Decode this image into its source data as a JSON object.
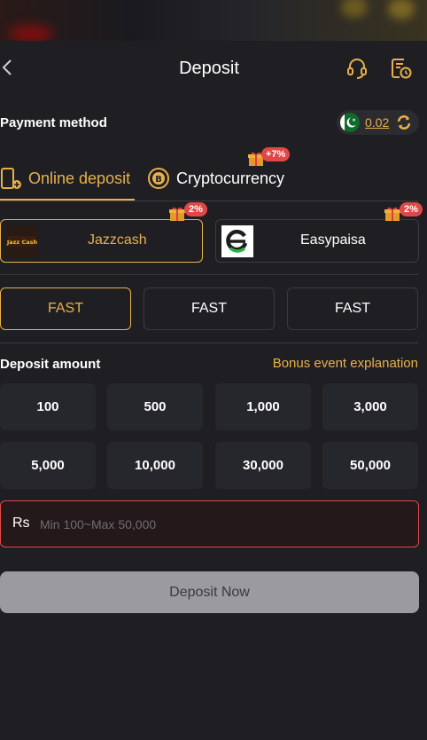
{
  "header": {
    "title": "Deposit",
    "back_icon": "chevron-left-icon",
    "support_icon": "headset-icon",
    "history_icon": "history-icon"
  },
  "payment_method": {
    "label": "Payment method",
    "balance": "0.02",
    "flag_icon": "pakistan-flag-icon",
    "refresh_icon": "refresh-icon"
  },
  "tabs": [
    {
      "label": "Online deposit",
      "active": true
    },
    {
      "label": "Cryptocurrency",
      "active": false,
      "badge": "+7%"
    }
  ],
  "channels": [
    {
      "label": "Jazzcash",
      "logo_text": "Jazz Cash",
      "badge": "2%",
      "selected": true
    },
    {
      "label": "Easypaisa",
      "badge": "2%",
      "selected": false
    }
  ],
  "speeds": [
    {
      "label": "FAST",
      "selected": true
    },
    {
      "label": "FAST",
      "selected": false
    },
    {
      "label": "FAST",
      "selected": false
    }
  ],
  "deposit_amount": {
    "label": "Deposit amount",
    "bonus_link": "Bonus event explanation",
    "amounts": [
      "100",
      "500",
      "1,000",
      "3,000",
      "5,000",
      "10,000",
      "30,000",
      "50,000"
    ]
  },
  "input": {
    "currency": "Rs",
    "placeholder": "Min 100~Max 50,000",
    "value": ""
  },
  "submit": {
    "label": "Deposit Now"
  },
  "colors": {
    "accent": "#e8b04b",
    "background": "#1f1f23",
    "badge": "#e04848",
    "button_disabled": "#9b9b9f"
  }
}
